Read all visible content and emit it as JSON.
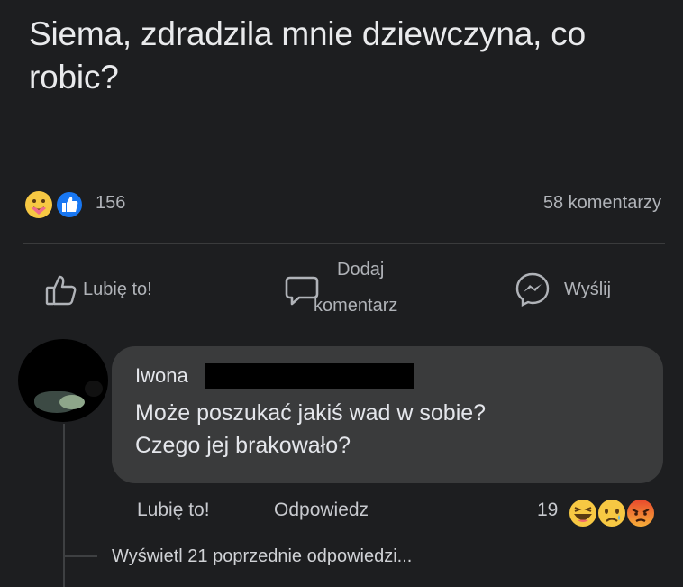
{
  "post": {
    "text": "Siema, zdradzila mnie dziewczyna, co robic?"
  },
  "reactions": {
    "icons": [
      "care-emoji-icon",
      "like-thumb-icon"
    ],
    "count": "156",
    "comments_count": "58 komentarzy"
  },
  "actions": {
    "like": "Lubię to!",
    "comment_line1": "Dodaj",
    "comment_line2": "komentarz",
    "send": "Wyślij"
  },
  "comment": {
    "author": "Iwona",
    "text_line1": "Może poszukać jakiś wad w sobie?",
    "text_line2": "Czego jej brakowało?",
    "like": "Lubię to!",
    "reply": "Odpowiedz",
    "reaction_count": "19",
    "reaction_icons": [
      "haha-emoji-icon",
      "sad-emoji-icon",
      "angry-emoji-icon"
    ]
  },
  "view_replies": "Wyświetl 21 poprzednie odpowiedzi...",
  "colors": {
    "background": "#1d1e20",
    "bubble": "#3a3b3c",
    "text": "#e4e6eb",
    "secondary": "#b0b3b8",
    "like_blue": "#1877f2"
  }
}
